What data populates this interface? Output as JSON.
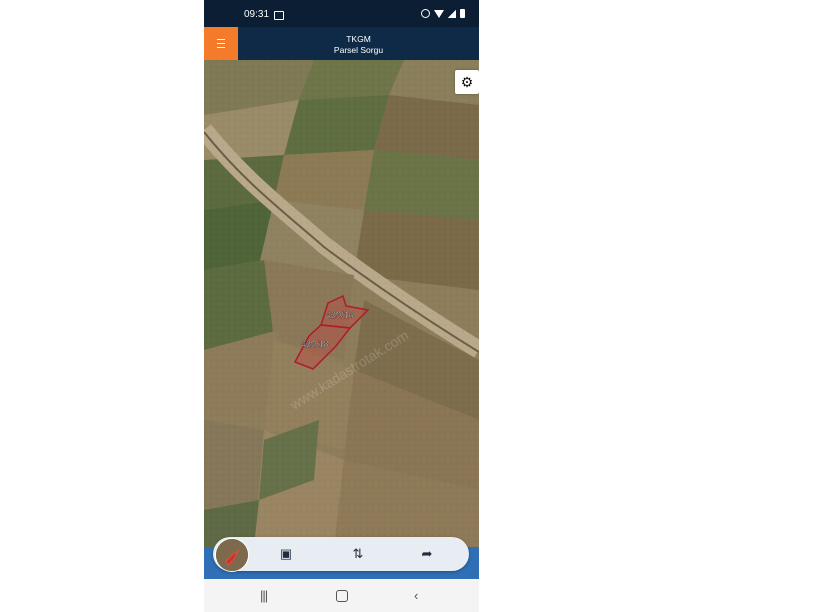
{
  "statusbar": {
    "time": "09:31"
  },
  "header": {
    "title": "TKGM",
    "subtitle": "Parsel Sorgu"
  },
  "icons": {
    "menu": "hamburger-icon",
    "settings": "gear-icon",
    "scan": "scan-icon",
    "swap": "swap-icon",
    "share": "share-icon",
    "measure": "ruler-icon"
  },
  "map": {
    "parcels": [
      {
        "label": "429/16"
      },
      {
        "label": "429/18"
      }
    ],
    "watermark": "www.kadastrotak.com"
  },
  "colors": {
    "header_bg": "#0f2a47",
    "menu_button": "#f47b2a",
    "parcel_outline": "#b01a2a",
    "toolbar_blue": "#2f6fb5"
  }
}
